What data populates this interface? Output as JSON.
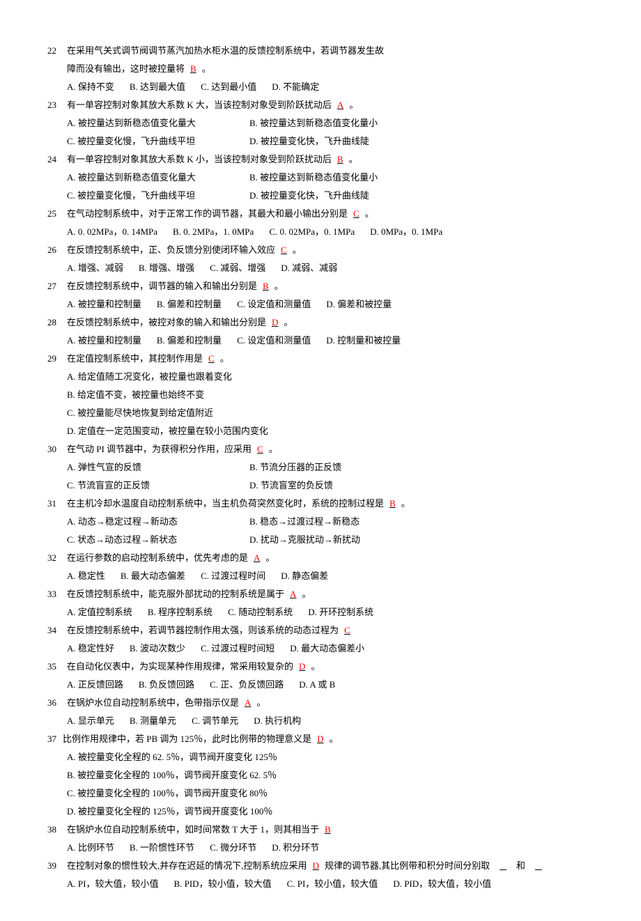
{
  "questions": [
    {
      "num": "22",
      "stem_pre": "在采用气关式调节阀调节蒸汽加热水柜水温的反馈控制系统中，若调节器发生故",
      "stem_line2_pre": "障而没有输出，这时被控量将",
      "ans": "B",
      "stem_post": "。",
      "opts": [
        "A. 保持不变",
        "B. 达到最大值",
        "C. 达到最小值",
        "D. 不能确定"
      ]
    },
    {
      "num": "23",
      "stem_pre": "有一单容控制对象其放大系数 K 大，当该控制对象受到阶跃扰动后",
      "ans": "A",
      "stem_post": "。",
      "opts_lines": [
        [
          "A. 被控量达到新稳态值变化量大",
          "B. 被控量达到新稳态值变化量小"
        ],
        [
          "C. 被控量变化慢，飞升曲线平坦",
          "D. 被控量变化快，飞升曲线陡"
        ]
      ]
    },
    {
      "num": "24",
      "stem_pre": "有一单容控制对象其放大系数 K 小，当该控制对象受到阶跃扰动后",
      "ans": "B",
      "stem_post": "。",
      "opts_lines": [
        [
          "A. 被控量达到新稳态值变化量大",
          "B. 被控量达到新稳态值变化量小"
        ],
        [
          "C. 被控量变化慢，飞升曲线平坦",
          "D. 被控量变化快，飞升曲线陡"
        ]
      ]
    },
    {
      "num": "25",
      "stem_pre": "在气动控制系统中，对于正常工作的调节器，其最大和最小输出分别是",
      "ans": "C",
      "stem_post": "。",
      "opts": [
        "A. 0. 02MPa，0. 14MPa",
        "B. 0. 2MPa，1. 0MPa",
        "C. 0. 02MPa，0. 1MPa",
        "D. 0MPa，0. 1MPa"
      ]
    },
    {
      "num": "26",
      "stem_pre": "在反馈控制系统中，正、负反馈分别使闭环输入效应",
      "ans": "C",
      "stem_post": "。",
      "opts": [
        "A. 增强、减弱",
        "B. 增强、增强",
        "C. 减弱、增强",
        "D. 减弱、减弱"
      ]
    },
    {
      "num": "27",
      "stem_pre": "在反馈控制系统中，调节器的输入和输出分别是",
      "ans": "B",
      "stem_post": "。",
      "opts": [
        "A. 被控量和控制量",
        "B. 偏差和控制量",
        "C. 设定值和测量值",
        "D. 偏差和被控量"
      ]
    },
    {
      "num": "28",
      "stem_pre": "在反馈控制系统中，被控对象的输入和输出分别是",
      "ans": "D",
      "stem_post": "。",
      "opts": [
        "A. 被控量和控制量",
        "B. 偏差和控制量",
        "C. 设定值和测量值",
        "D. 控制量和被控量"
      ]
    },
    {
      "num": "29",
      "stem_pre": "在定值控制系统中，其控制作用是",
      "ans": "C",
      "stem_post": "。",
      "opts_lines": [
        [
          "A. 给定值随工况变化，被控量也跟着变化"
        ],
        [
          "B. 给定值不变，被控量也始终不变"
        ],
        [
          "C. 被控量能尽快地恢复到给定值附近"
        ],
        [
          "D. 定值在一定范围变动，被控量在较小范围内变化"
        ]
      ]
    },
    {
      "num": "30",
      "stem_pre": "在气动 PI 调节器中，为获得积分作用，应采用",
      "ans": "C",
      "stem_post": "。",
      "opts_lines": [
        [
          "A. 弹性气宣的反馈",
          "B. 节流分压器的正反馈"
        ],
        [
          "C. 节流盲宣的正反馈",
          "D. 节流盲室的负反馈"
        ]
      ]
    },
    {
      "num": "31",
      "stem_pre": "在主机冷却水温度自动控制系统中，当主机负荷突然变化时，系统的控制过程是",
      "ans": "B",
      "stem_post": "。",
      "opts_lines": [
        [
          "A. 动态→稳定过程→新动态",
          "B. 稳态→过渡过程→新稳态"
        ],
        [
          "C. 状态→动态过程→新状态",
          "D. 扰动→克服扰动→新扰动"
        ]
      ]
    },
    {
      "num": "32",
      "stem_pre": "在运行参数的启动控制系统中，优先考虑的是",
      "ans": "A",
      "stem_post": "。",
      "opts": [
        "A. 稳定性",
        "B. 最大动态偏差",
        "C. 过渡过程时间",
        "D. 静态偏差"
      ]
    },
    {
      "num": "33",
      "stem_pre": "在反馈控制系统中，能克服外部扰动的控制系统是属于",
      "ans": "A",
      "stem_post": "。",
      "opts": [
        "A. 定值控制系统",
        "B. 程序控制系统",
        "C. 随动控制系统",
        "D. 开环控制系统"
      ]
    },
    {
      "num": "34",
      "stem_pre": "在反馈控制系统中，若调节器控制作用太强，则该系统的动态过程为",
      "ans": "C",
      "stem_post": "",
      "opts": [
        "A. 稳定性好",
        "B. 波动次数少",
        "C. 过渡过程时间短",
        "D. 最大动态偏差小"
      ]
    },
    {
      "num": "35",
      "stem_pre": "在自动化仪表中，为实现某种作用规律，常采用较复杂的",
      "ans": "D",
      "stem_post": "。",
      "opts": [
        "A. 正反馈回路",
        "B. 负反馈回路",
        "C. 正、负反馈回路",
        "D. A 或 B"
      ]
    },
    {
      "num": "36",
      "stem_pre": "在锅炉水位自动控制系统中，色带指示仪是",
      "ans": "A",
      "stem_post": "。",
      "opts": [
        "A. 显示单元",
        "B. 测量单元",
        "C. 调节单元",
        "D. 执行机构"
      ]
    },
    {
      "num": "37",
      "stem_pre": "比例作用规律中，若 PB 调为 125％，此时比例带的物理意义是",
      "ans": "D",
      "stem_post": "。",
      "opts_lines": [
        [
          "A. 被控量变化全程的 62. 5％，调节阀开度变化 125％"
        ],
        [
          "B. 被控量变化全程的 100％，调节阀开度变化 62. 5％"
        ],
        [
          "C. 被控量变化全程的 100％，调节阀开度变化 80％"
        ],
        [
          "D. 被控量变化全程的 125％，调节阀开度变化 100％"
        ]
      ],
      "tight_num": true
    },
    {
      "num": "38",
      "stem_pre": "在锅炉水位自动控制系统中，如时间常数 T 大于 1，则其相当于",
      "ans": "B",
      "stem_post": "",
      "opts": [
        "A. 比例环节",
        "B. 一阶惯性环节",
        "C. 微分环节",
        "D. 积分环节"
      ]
    },
    {
      "num": "39",
      "stem_pre": "在控制对象的惯性较大,并存在迟延的情况下,控制系统应采用",
      "ans": "D",
      "stem_mid": "规律的调节器,其比例带和积分时间分别取",
      "stem_post": "和",
      "trailing_blanks": true,
      "opts": [
        "A. PI，较大值，较小值",
        "B. PID，较小值，较大值",
        "C. PI，较小值，较大值",
        "D. PID，较大值，较小值"
      ]
    }
  ]
}
